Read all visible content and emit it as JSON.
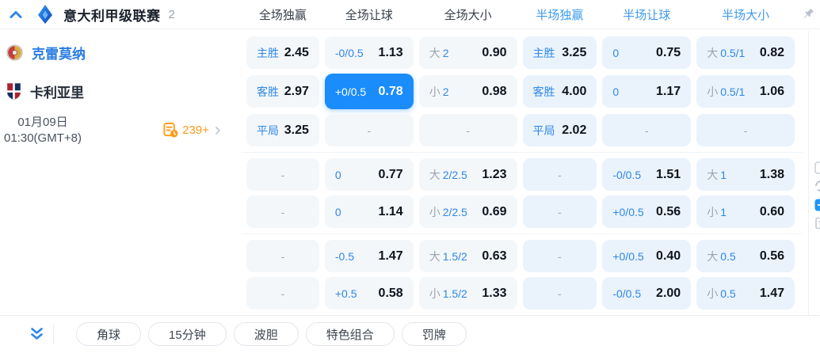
{
  "header": {
    "league": "意大利甲级联赛",
    "count": "2",
    "full_columns": [
      "全场独赢",
      "全场让球",
      "全场大小"
    ],
    "half_columns": [
      "半场独赢",
      "半场让球",
      "半场大小"
    ]
  },
  "match": {
    "home_team": "克雷莫纳",
    "away_team": "卡利亚里",
    "date": "01月09日",
    "time": "01:30(GMT+8)",
    "extra_markets": "239+"
  },
  "odds": {
    "sections": [
      {
        "rows": [
          [
            {
              "label": "主胜",
              "value": "2.45"
            },
            {
              "label": "-0/0.5",
              "value": "1.13"
            },
            {
              "prefix": "大",
              "label": "2",
              "value": "0.90"
            },
            {
              "label": "主胜",
              "value": "3.25"
            },
            {
              "label": "0",
              "value": "0.75"
            },
            {
              "prefix": "大",
              "label": "0.5/1",
              "value": "0.82"
            }
          ],
          [
            {
              "label": "客胜",
              "value": "2.97"
            },
            {
              "label": "+0/0.5",
              "value": "0.78",
              "selected": true
            },
            {
              "prefix": "小",
              "label": "2",
              "value": "0.98"
            },
            {
              "label": "客胜",
              "value": "4.00"
            },
            {
              "label": "0",
              "value": "1.17"
            },
            {
              "prefix": "小",
              "label": "0.5/1",
              "value": "1.06"
            }
          ],
          [
            {
              "label": "平局",
              "value": "3.25"
            },
            {
              "value": "-"
            },
            {
              "value": "-"
            },
            {
              "label": "平局",
              "value": "2.02"
            },
            {
              "value": "-"
            },
            {
              "value": "-"
            }
          ]
        ]
      },
      {
        "rows": [
          [
            {
              "value": "-"
            },
            {
              "label": "0",
              "value": "0.77"
            },
            {
              "prefix": "大",
              "label": "2/2.5",
              "value": "1.23"
            },
            {
              "value": "-"
            },
            {
              "label": "-0/0.5",
              "value": "1.51"
            },
            {
              "prefix": "大",
              "label": "1",
              "value": "1.38"
            }
          ],
          [
            {
              "value": "-"
            },
            {
              "label": "0",
              "value": "1.14"
            },
            {
              "prefix": "小",
              "label": "2/2.5",
              "value": "0.69"
            },
            {
              "value": "-"
            },
            {
              "label": "+0/0.5",
              "value": "0.56"
            },
            {
              "prefix": "小",
              "label": "1",
              "value": "0.60"
            }
          ]
        ]
      },
      {
        "rows": [
          [
            {
              "value": "-"
            },
            {
              "label": "-0.5",
              "value": "1.47"
            },
            {
              "prefix": "大",
              "label": "1.5/2",
              "value": "0.63"
            },
            {
              "value": "-"
            },
            {
              "label": "+0/0.5",
              "value": "0.40"
            },
            {
              "prefix": "大",
              "label": "0.5",
              "value": "0.56"
            }
          ],
          [
            {
              "value": "-"
            },
            {
              "label": "+0.5",
              "value": "0.58"
            },
            {
              "prefix": "小",
              "label": "1.5/2",
              "value": "1.33"
            },
            {
              "value": "-"
            },
            {
              "label": "-0/0.5",
              "value": "2.00"
            },
            {
              "prefix": "小",
              "label": "0.5",
              "value": "1.47"
            }
          ]
        ]
      }
    ]
  },
  "footer": {
    "buttons": [
      "角球",
      "15分钟",
      "波胆",
      "特色组合",
      "罚牌"
    ]
  },
  "icons": {
    "collapse": "chevron-up-icon",
    "league": "serie-a-logo-icon",
    "pin": "pin-icon",
    "markets": "markets-history-icon",
    "more": "chevron-right-icon",
    "expand": "double-chevron-down-icon"
  },
  "colors": {
    "selected_bg": "#1a8cfb",
    "label_blue": "#2e87e8",
    "half_header_blue": "#3d9af0",
    "orange": "#ff9b19"
  }
}
